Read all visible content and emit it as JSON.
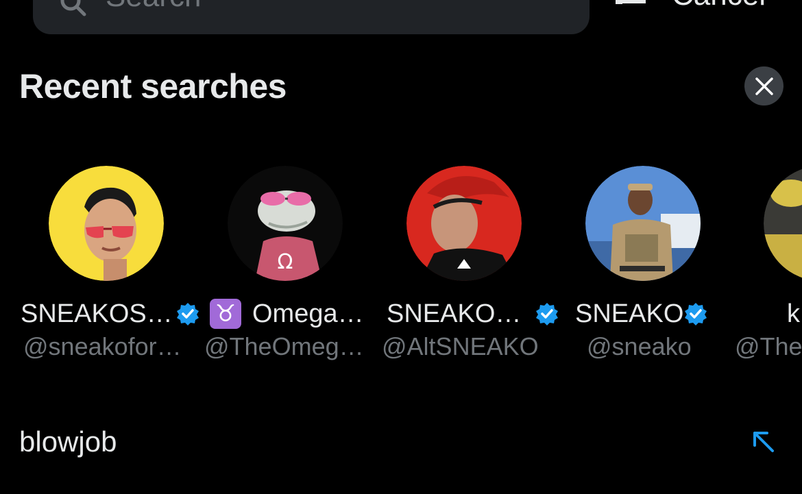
{
  "search": {
    "placeholder": "Search",
    "cancel_label": "Cancel"
  },
  "recent": {
    "title": "Recent searches",
    "accounts": [
      {
        "name": "SNEAKOS…",
        "handle": "@sneakofor…",
        "verified": true
      },
      {
        "name": "Omega…",
        "handle": "@TheOmeg…",
        "verified": false,
        "emoji": "♉"
      },
      {
        "name": "SNEAKO…",
        "handle": "@AltSNEAKO",
        "verified": true
      },
      {
        "name": "SNEAKO",
        "handle": "@sneako",
        "verified": true
      },
      {
        "name": "k",
        "handle": "@The",
        "verified": false
      }
    ],
    "queries": [
      {
        "text": "blowjob"
      }
    ]
  },
  "colors": {
    "background": "#000000",
    "primary_text": "#e7e9ea",
    "secondary_text": "#71767b",
    "accent": "#1d9bf0",
    "search_bg": "#202327",
    "clear_button_bg": "#3b3f44"
  },
  "icons": {
    "search": "search-icon",
    "filter": "filter-icon",
    "clear": "close-icon",
    "verified": "verified-badge-icon",
    "fill_query": "arrow-up-left-icon"
  }
}
